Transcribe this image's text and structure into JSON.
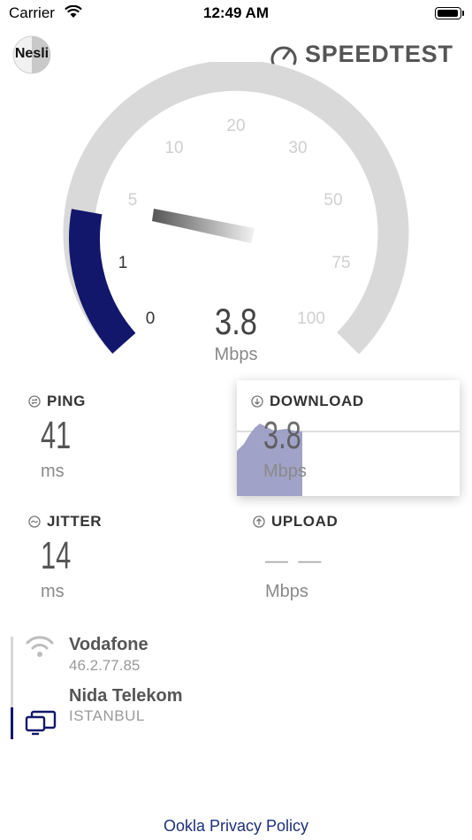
{
  "status_bar": {
    "carrier": "Carrier",
    "time": "12:49 AM",
    "wifi_icon": "wifi-icon",
    "battery_level": 1.0
  },
  "header": {
    "avatar_label": "Nesli",
    "brand": "SPEEDTEST",
    "brand_icon": "speedometer-icon"
  },
  "gauge": {
    "ticks": [
      "0",
      "1",
      "5",
      "10",
      "20",
      "30",
      "50",
      "75",
      "100"
    ],
    "value": "3.8",
    "unit": "Mbps",
    "progress_color": "#12176b",
    "track_color": "#d9d9d9"
  },
  "metrics": {
    "ping": {
      "label": "PING",
      "value": "41",
      "unit": "ms",
      "icon": "ping-icon"
    },
    "download": {
      "label": "DOWNLOAD",
      "value": "3.8",
      "unit": "Mbps",
      "icon": "download-arrow-icon"
    },
    "jitter": {
      "label": "JITTER",
      "value": "14",
      "unit": "ms",
      "icon": "jitter-icon"
    },
    "upload": {
      "label": "UPLOAD",
      "value": "— —",
      "unit": "Mbps",
      "icon": "upload-arrow-icon"
    }
  },
  "server": {
    "isp_name": "Vodafone",
    "isp_ip": "46.2.77.85",
    "server_name": "Nida Telekom",
    "server_location": "ISTANBUL"
  },
  "footer": {
    "privacy_link": "Ookla Privacy Policy"
  },
  "colors": {
    "accent": "#12176b",
    "graph_fill": "#9b9dc4"
  }
}
